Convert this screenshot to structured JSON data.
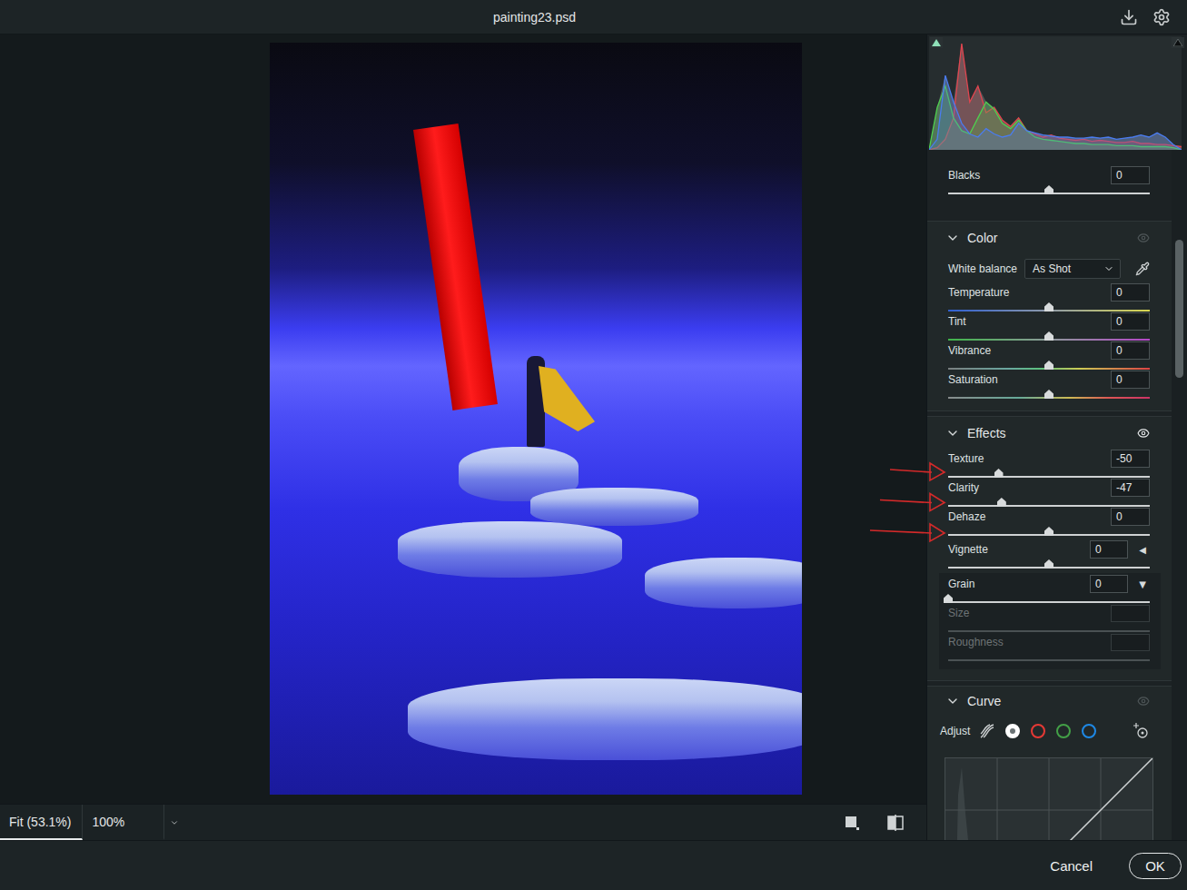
{
  "window": {
    "title": "painting23.psd"
  },
  "canvas": {
    "zoom_tabs": [
      {
        "label": "Fit (53.1%)",
        "selected": true
      },
      {
        "label": "100%",
        "selected": false
      }
    ]
  },
  "histogram": {
    "series": [
      {
        "name": "red",
        "color": "#e0454f",
        "values": [
          0,
          2,
          10,
          30,
          100,
          45,
          60,
          35,
          40,
          28,
          22,
          30,
          18,
          15,
          12,
          14,
          11,
          10,
          9,
          10,
          8,
          9,
          8,
          7,
          7,
          8,
          6,
          6,
          5,
          5,
          4,
          3
        ]
      },
      {
        "name": "green",
        "color": "#4fd04f",
        "values": [
          0,
          40,
          60,
          30,
          18,
          15,
          30,
          45,
          38,
          25,
          20,
          28,
          18,
          12,
          10,
          9,
          8,
          7,
          6,
          6,
          5,
          5,
          5,
          4,
          4,
          4,
          3,
          3,
          3,
          3,
          2,
          0
        ]
      },
      {
        "name": "blue",
        "color": "#4a7cf0",
        "values": [
          0,
          10,
          70,
          45,
          25,
          15,
          12,
          20,
          15,
          12,
          14,
          25,
          18,
          16,
          14,
          13,
          12,
          12,
          11,
          11,
          12,
          11,
          12,
          10,
          11,
          12,
          14,
          12,
          16,
          12,
          5,
          0
        ]
      }
    ]
  },
  "basic": {
    "sliders": [
      {
        "label": "Blacks",
        "value": "0",
        "level": 0.5
      }
    ]
  },
  "color_panel": {
    "title": "Color",
    "expanded": true,
    "eye_on": false,
    "white_balance": {
      "label": "White balance",
      "value": "As Shot"
    },
    "sliders": [
      {
        "label": "Temperature",
        "value": "0",
        "level": 0.5,
        "kind": "temperature"
      },
      {
        "label": "Tint",
        "value": "0",
        "level": 0.5,
        "kind": "tint"
      },
      {
        "label": "Vibrance",
        "value": "0",
        "level": 0.5,
        "kind": "vibrance"
      },
      {
        "label": "Saturation",
        "value": "0",
        "level": 0.5,
        "kind": "saturation"
      }
    ]
  },
  "effects_panel": {
    "title": "Effects",
    "expanded": true,
    "eye_on": true,
    "sliders": [
      {
        "label": "Texture",
        "value": "-50",
        "level": 0.25,
        "marked": true,
        "kind": "plain"
      },
      {
        "label": "Clarity",
        "value": "-47",
        "level": 0.265,
        "marked": true,
        "kind": "plain"
      },
      {
        "label": "Dehaze",
        "value": "0",
        "level": 0.5,
        "marked": true,
        "kind": "plain"
      },
      {
        "label": "Vignette",
        "value": "0",
        "level": 0.5,
        "marked": false,
        "kind": "toggle",
        "toggle": "◀",
        "expanded": false
      }
    ],
    "grain": {
      "label": "Grain",
      "value": "0",
      "level": 0,
      "toggle": "▼",
      "expanded": true,
      "settings": [
        {
          "label": "Size",
          "disabled": true
        },
        {
          "label": "Roughness",
          "disabled": true
        }
      ]
    }
  },
  "curve_panel": {
    "title": "Curve",
    "expanded": true,
    "eye_on": false,
    "adjust_label": "Adjust",
    "channels": [
      {
        "kind": "parametric",
        "selected": false,
        "color": "#cfd3d4"
      },
      {
        "kind": "ring",
        "selected": true,
        "color": "#ffffff"
      },
      {
        "kind": "ring",
        "selected": false,
        "color": "#e53935"
      },
      {
        "kind": "ring",
        "selected": false,
        "color": "#43a047"
      },
      {
        "kind": "ring",
        "selected": false,
        "color": "#1e88e5"
      }
    ]
  },
  "scrollbar": {
    "offset": 0.13,
    "level": 0.2
  },
  "footer": {
    "buttons": [
      {
        "label": "Cancel",
        "primary": false
      },
      {
        "label": "OK",
        "primary": true
      }
    ]
  }
}
